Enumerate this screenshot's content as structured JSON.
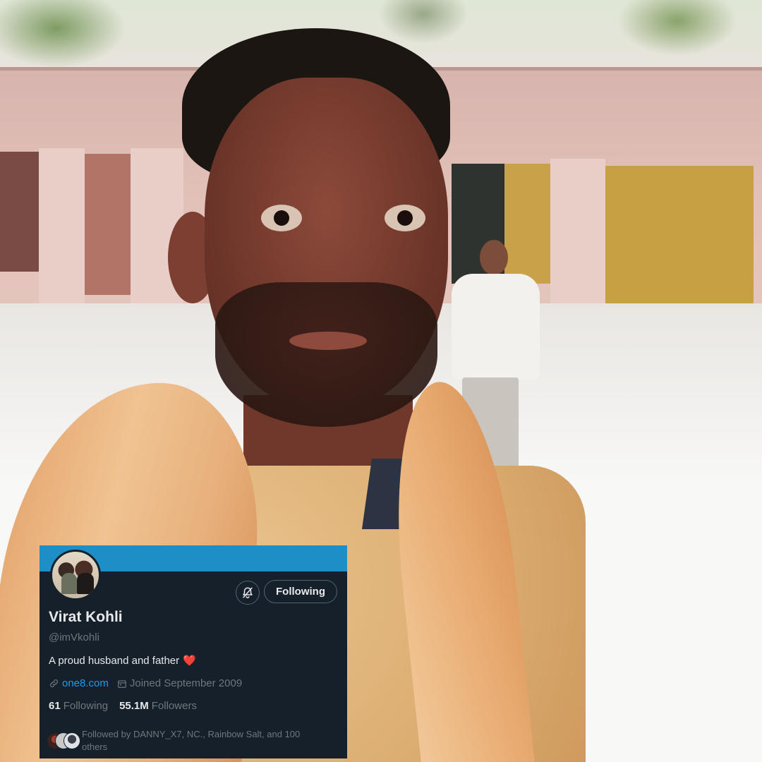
{
  "profile": {
    "name": "Virat Kohli",
    "handle": "@imVkohli",
    "bio": "A proud husband and father",
    "bio_emoji": "❤️",
    "website": "one8.com",
    "joined": "Joined September 2009",
    "following_count": "61",
    "following_label": "Following",
    "followers_count": "55.1M",
    "followers_label": "Followers",
    "follow_button_label": "Following",
    "followed_by": "Followed by DANNY_X7, NC., Rainbow Salt, and 100 others"
  },
  "icons": {
    "notification": "bell-icon",
    "website": "link-icon",
    "joined": "calendar-icon"
  },
  "colors": {
    "card_background": "#15202b",
    "banner": "#1d8fc6",
    "link": "#1d9bf0",
    "muted_text": "#71767b"
  }
}
